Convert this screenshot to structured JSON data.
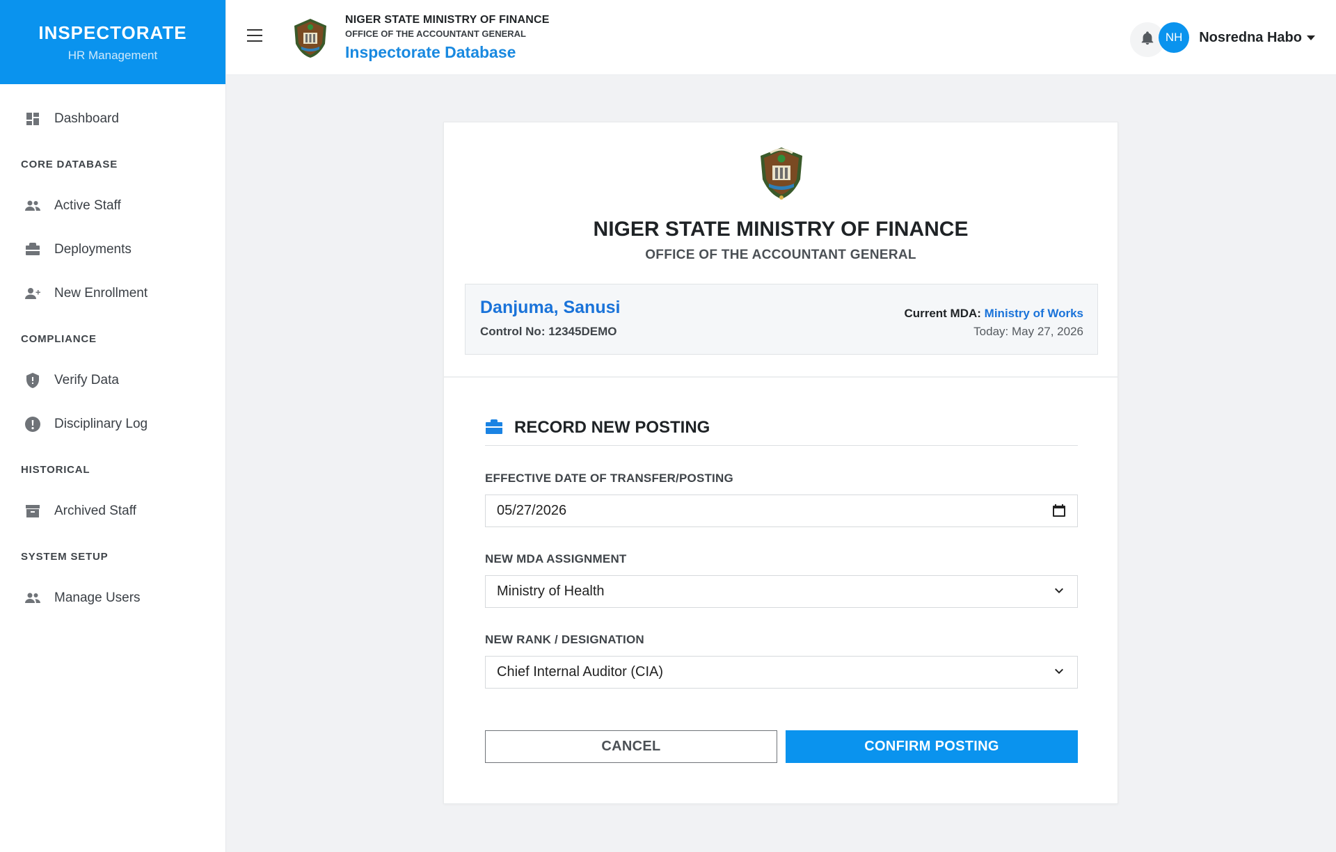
{
  "brand": {
    "title": "INSPECTORATE",
    "subtitle": "HR Management",
    "color": "#0a93ee"
  },
  "sidebar": {
    "dashboard": "Dashboard",
    "sections": {
      "core": "CORE DATABASE",
      "compliance": "COMPLIANCE",
      "historical": "HISTORICAL",
      "setup": "SYSTEM SETUP"
    },
    "items": {
      "active_staff": "Active Staff",
      "deployments": "Deployments",
      "new_enrollment": "New Enrollment",
      "verify_data": "Verify Data",
      "disciplinary_log": "Disciplinary Log",
      "archived_staff": "Archived Staff",
      "manage_users": "Manage Users"
    }
  },
  "header": {
    "line1": "NIGER STATE MINISTRY OF FINANCE",
    "line2": "OFFICE OF THE ACCOUNTANT GENERAL",
    "app_name": "Inspectorate Database",
    "user": {
      "initials": "NH",
      "name": "Nosredna Habo"
    }
  },
  "card": {
    "title": "NIGER STATE MINISTRY OF FINANCE",
    "subtitle": "OFFICE OF THE ACCOUNTANT GENERAL",
    "staff": {
      "name": "Danjuma, Sanusi",
      "control_no": "Control No: 12345DEMO",
      "current_mda_label": "Current MDA:",
      "current_mda": "Ministry of Works",
      "today": "Today: May 27, 2026"
    },
    "section_title": "RECORD NEW POSTING",
    "form": {
      "date_label": "EFFECTIVE DATE OF TRANSFER/POSTING",
      "date_value": "05/27/2026",
      "mda_label": "NEW MDA ASSIGNMENT",
      "mda_value": "Ministry of Health",
      "rank_label": "NEW RANK / DESIGNATION",
      "rank_value": "Chief Internal Auditor (CIA)"
    },
    "buttons": {
      "cancel": "CANCEL",
      "confirm": "CONFIRM POSTING"
    }
  }
}
